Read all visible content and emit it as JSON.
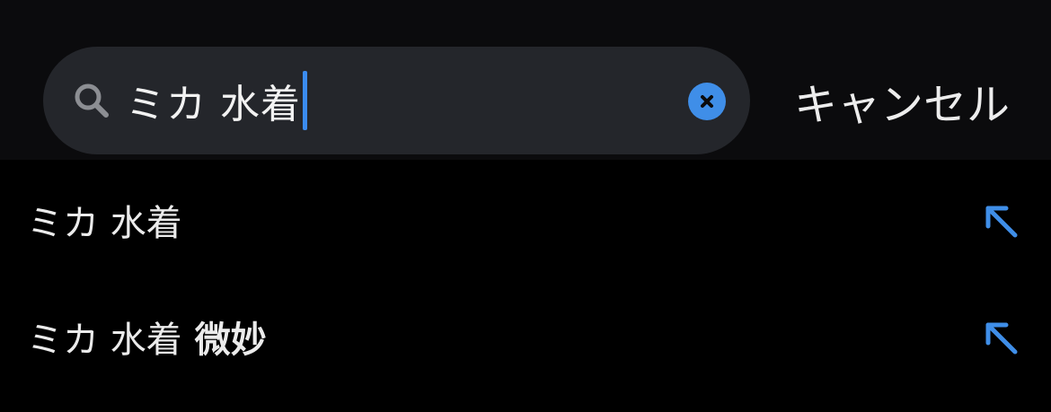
{
  "search": {
    "query": "ミカ 水着",
    "icon": "search-icon",
    "clear_icon": "clear-icon",
    "cancel_label": "キャンセル"
  },
  "suggestions": [
    {
      "base": "ミカ 水着",
      "extra": "",
      "icon": "arrow-up-left-icon"
    },
    {
      "base": "ミカ 水着",
      "extra": "微妙",
      "icon": "arrow-up-left-icon"
    }
  ],
  "colors": {
    "accent": "#3f8ee8",
    "background": "#000000",
    "header": "#0b0b0d",
    "search_field": "#24262b",
    "text": "#ebebeb"
  }
}
